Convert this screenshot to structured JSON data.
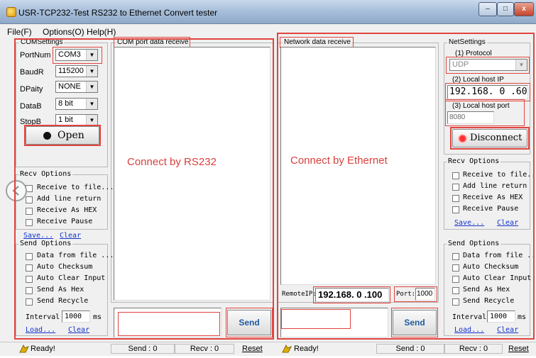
{
  "window": {
    "title": "USR-TCP232-Test  RS232 to Ethernet Convert tester",
    "min": "–",
    "max": "□",
    "close": "x"
  },
  "menu": {
    "file": "File(F)",
    "options": "Options(O)",
    "help": "Help(H)"
  },
  "com_settings": {
    "title": "COMSettings",
    "port_label": "PortNum",
    "port_value": "COM3",
    "baud_label": "BaudR",
    "baud_value": "115200",
    "parity_label": "DPaity",
    "parity_value": "NONE",
    "databits_label": "DataB",
    "databits_value": "8 bit",
    "stopbits_label": "StopB",
    "stopbits_value": "1 bit",
    "open_button": "Open"
  },
  "left_recv": {
    "title": "Recv Options",
    "opt1": "Receive to file...",
    "opt2": "Add line return",
    "opt3": "Receive As HEX",
    "opt4": "Receive Pause",
    "save": "Save...",
    "clear": "Clear"
  },
  "left_send": {
    "title": "Send Options",
    "opt1": "Data from file ...",
    "opt2": "Auto Checksum",
    "opt3": "Auto Clear Input",
    "opt4": "Send As Hex",
    "opt5": "Send Recycle",
    "interval_label": "Interval",
    "interval_value": "1000",
    "interval_unit": "ms",
    "load": "Load...",
    "clear": "Clear"
  },
  "com_receive": {
    "title": "COM port data receive",
    "overlay": "Connect by RS232",
    "send_button": "Send"
  },
  "net_receive": {
    "title": "Network data receive",
    "overlay": "Connect by Ethernet",
    "remote_ip_label": "RemoteIP:",
    "remote_ip_value": "192.168. 0 .100",
    "port_label": "Port:",
    "port_value": "1000",
    "send_button": "Send"
  },
  "net_settings": {
    "title": "NetSettings",
    "protocol_label": "(1) Protocol",
    "protocol_value": "UDP",
    "local_ip_label": "(2) Local host IP",
    "local_ip_value": "192.168. 0 .60",
    "local_port_label": "(3) Local host port",
    "local_port_value": "8080",
    "disconnect_button": "Disconnect"
  },
  "right_recv": {
    "title": "Recv Options",
    "opt1": "Receive to file...",
    "opt2": "Add line return",
    "opt3": "Receive As HEX",
    "opt4": "Receive Pause",
    "save": "Save...",
    "clear": "Clear"
  },
  "right_send": {
    "title": "Send Options",
    "opt1": "Data from file ...",
    "opt2": "Auto Checksum",
    "opt3": "Auto Clear Input",
    "opt4": "Send As Hex",
    "opt5": "Send Recycle",
    "interval_label": "Interval",
    "interval_value": "1000",
    "interval_unit": "ms",
    "load": "Load...",
    "clear": "Clear"
  },
  "status_left": {
    "ready": "Ready!",
    "send": "Send : 0",
    "recv": "Recv : 0",
    "reset": "Reset"
  },
  "status_right": {
    "ready": "Ready!",
    "send": "Send : 0",
    "recv": "Recv : 0",
    "reset": "Reset"
  },
  "colors": {
    "annotation": "#e0453f",
    "open_indicator": "#111111",
    "disconnect_indicator": "#e02020"
  }
}
